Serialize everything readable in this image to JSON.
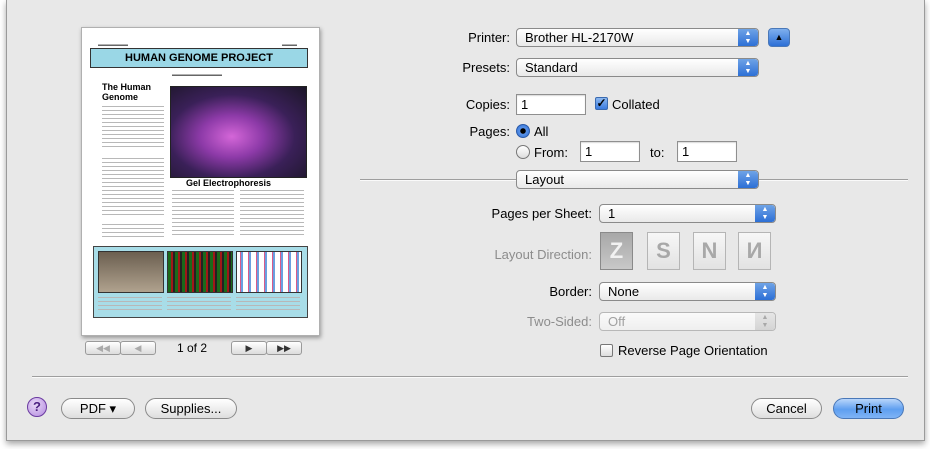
{
  "preview": {
    "banner_title": "HUMAN GENOME PROJECT",
    "heading_human_genome": "The Human Genome",
    "heading_gel": "Gel Electrophoresis",
    "page_indicator": "1 of 2",
    "nav": {
      "first": "◀◀",
      "prev": "◀",
      "next": "▶",
      "last": "▶▶"
    }
  },
  "printer": {
    "label": "Printer:",
    "value": "Brother HL-2170W"
  },
  "presets": {
    "label": "Presets:",
    "value": "Standard"
  },
  "copies": {
    "label": "Copies:",
    "value": "1",
    "collated_label": "Collated",
    "collated_checked": true
  },
  "pages": {
    "label": "Pages:",
    "all_label": "All",
    "from_label": "From:",
    "from_value": "1",
    "to_label": "to:",
    "to_value": "1",
    "selected": "all"
  },
  "section_popup": {
    "value": "Layout"
  },
  "layout": {
    "pages_per_sheet_label": "Pages per Sheet:",
    "pages_per_sheet_value": "1",
    "direction_label": "Layout Direction:",
    "border_label": "Border:",
    "border_value": "None",
    "two_sided_label": "Two-Sided:",
    "two_sided_value": "Off",
    "reverse_label": "Reverse Page Orientation",
    "reverse_checked": false
  },
  "footer": {
    "help": "?",
    "pdf": "PDF ▾",
    "supplies": "Supplies...",
    "cancel": "Cancel",
    "print": "Print"
  },
  "colors": {
    "accent": "#2c6fd6",
    "help": "#7a3db8",
    "dialog_bg": "#e8e8e8"
  },
  "icons": {
    "disclosure": "triangle-up-icon",
    "stepper": "updown-arrows-icon"
  }
}
